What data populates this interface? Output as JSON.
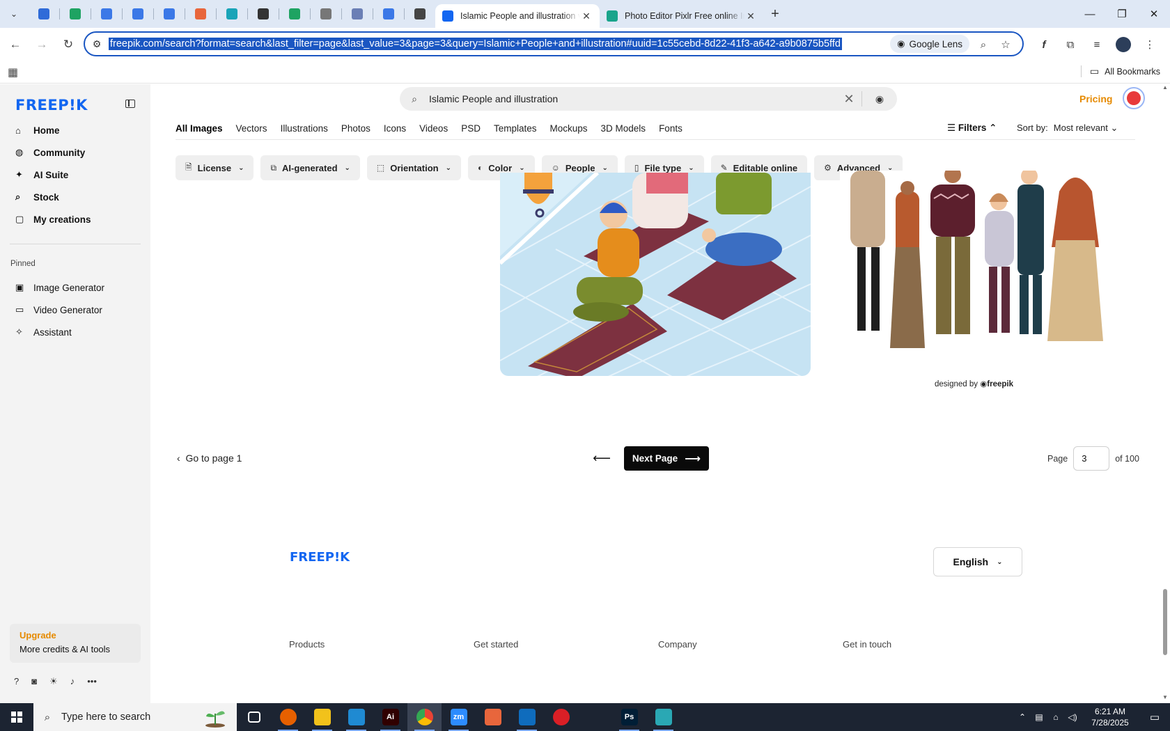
{
  "browser": {
    "pinned_tabs": [
      {
        "name": "wp-tab",
        "color": "#2f6bd8"
      },
      {
        "name": "sheets-tab-1",
        "color": "#1ea362"
      },
      {
        "name": "docs-tab-1",
        "color": "#3b78e7"
      },
      {
        "name": "docs-tab-2",
        "color": "#3b78e7"
      },
      {
        "name": "docs-tab-3",
        "color": "#3b78e7"
      },
      {
        "name": "pattern-tab",
        "color": "#e8663c"
      },
      {
        "name": "teal-tab",
        "color": "#19a4b8"
      },
      {
        "name": "openai-tab",
        "color": "#333333"
      },
      {
        "name": "sheets-tab-2",
        "color": "#1ea362"
      },
      {
        "name": "globe-tab",
        "color": "#777777"
      },
      {
        "name": "qr-tab",
        "color": "#6b7fb5"
      },
      {
        "name": "forms-tab",
        "color": "#3b78e7"
      },
      {
        "name": "audio-tab",
        "color": "#444444"
      }
    ],
    "active_tab": {
      "title": "Islamic People and illustration vectors",
      "close": "✕"
    },
    "other_tab": {
      "title": "Photo Editor Pixlr Free online Image",
      "close": "✕"
    },
    "new_tab": "+",
    "url": "freepik.com/search?format=search&last_filter=page&last_value=3&page=3&query=Islamic+People+and+illustration#uuid=1c55cebd-8d22-41f3-a642-a9b0875b5ffd",
    "google_lens": "Google Lens",
    "all_bookmarks": "All Bookmarks"
  },
  "sidebar": {
    "logo": "FREEP!K",
    "nav": [
      {
        "icon": "home-icon",
        "glyph": "⌂",
        "label": "Home"
      },
      {
        "icon": "globe-icon",
        "glyph": "◍",
        "label": "Community"
      },
      {
        "icon": "sparkle-icon",
        "glyph": "✦",
        "label": "AI Suite"
      },
      {
        "icon": "search-icon",
        "glyph": "⌕",
        "label": "Stock"
      },
      {
        "icon": "folder-icon",
        "glyph": "▢",
        "label": "My creations"
      }
    ],
    "pinned_label": "Pinned",
    "pinned": [
      {
        "icon": "image-icon",
        "glyph": "▣",
        "label": "Image Generator"
      },
      {
        "icon": "video-icon",
        "glyph": "▭",
        "label": "Video Generator"
      },
      {
        "icon": "assistant-icon",
        "glyph": "✧",
        "label": "Assistant"
      }
    ],
    "upgrade_title": "Upgrade",
    "upgrade_sub": "More credits & AI tools"
  },
  "header": {
    "search_query": "Islamic People and illustration",
    "pricing": "Pricing"
  },
  "type_tabs": [
    "All Images",
    "Vectors",
    "Illustrations",
    "Photos",
    "Icons",
    "Videos",
    "PSD",
    "Templates",
    "Mockups",
    "3D Models",
    "Fonts"
  ],
  "filters_label": "Filters",
  "sort_label": "Sort by:",
  "sort_value": "Most relevant",
  "chips": [
    {
      "icon": "license-icon",
      "glyph": "🗎",
      "label": "License"
    },
    {
      "icon": "ai-icon",
      "glyph": "⧉",
      "label": "AI-generated"
    },
    {
      "icon": "orientation-icon",
      "glyph": "⬚",
      "label": "Orientation"
    },
    {
      "icon": "palette-icon",
      "glyph": "◐",
      "label": "Color"
    },
    {
      "icon": "people-icon",
      "glyph": "☺",
      "label": "People"
    },
    {
      "icon": "file-icon",
      "glyph": "▯",
      "label": "File type"
    },
    {
      "icon": "pen-icon",
      "glyph": "✎",
      "label": "Editable online"
    },
    {
      "icon": "gear-icon",
      "glyph": "⚙",
      "label": "Advanced"
    }
  ],
  "credit": {
    "prefix": "designed by",
    "brand": "freepik"
  },
  "pagination": {
    "goto_label": "Go to page 1",
    "next_label": "Next Page",
    "page_label": "Page",
    "current_page": "3",
    "of_label": "of 100"
  },
  "footer": {
    "logo": "FREEP!K",
    "language": "English",
    "columns": [
      "Products",
      "Get started",
      "Company",
      "Get in touch"
    ]
  },
  "taskbar": {
    "search_placeholder": "Type here to search",
    "time": "6:21 AM",
    "date": "7/28/2025",
    "apps": [
      {
        "name": "task-view",
        "label": "",
        "color": "#1c2432"
      },
      {
        "name": "firefox",
        "label": "",
        "color": "#e66000"
      },
      {
        "name": "file-explorer",
        "label": "",
        "color": "#f2c21b"
      },
      {
        "name": "vscode",
        "label": "",
        "color": "#1f8ad2"
      },
      {
        "name": "illustrator",
        "label": "Ai",
        "color": "#300000"
      },
      {
        "name": "chrome",
        "label": "",
        "color": "#34a853"
      },
      {
        "name": "zoom",
        "label": "zm",
        "color": "#2d8cff"
      },
      {
        "name": "pattern-app",
        "label": "",
        "color": "#e8663c"
      },
      {
        "name": "outlook",
        "label": "",
        "color": "#0f6cbd"
      },
      {
        "name": "creative-cloud",
        "label": "",
        "color": "#da1f26"
      },
      {
        "name": "pen-app",
        "label": "",
        "color": "#1c2432"
      },
      {
        "name": "photoshop",
        "label": "Ps",
        "color": "#001e36"
      },
      {
        "name": "diamond-app",
        "label": "",
        "color": "#2aa8b4"
      }
    ]
  }
}
